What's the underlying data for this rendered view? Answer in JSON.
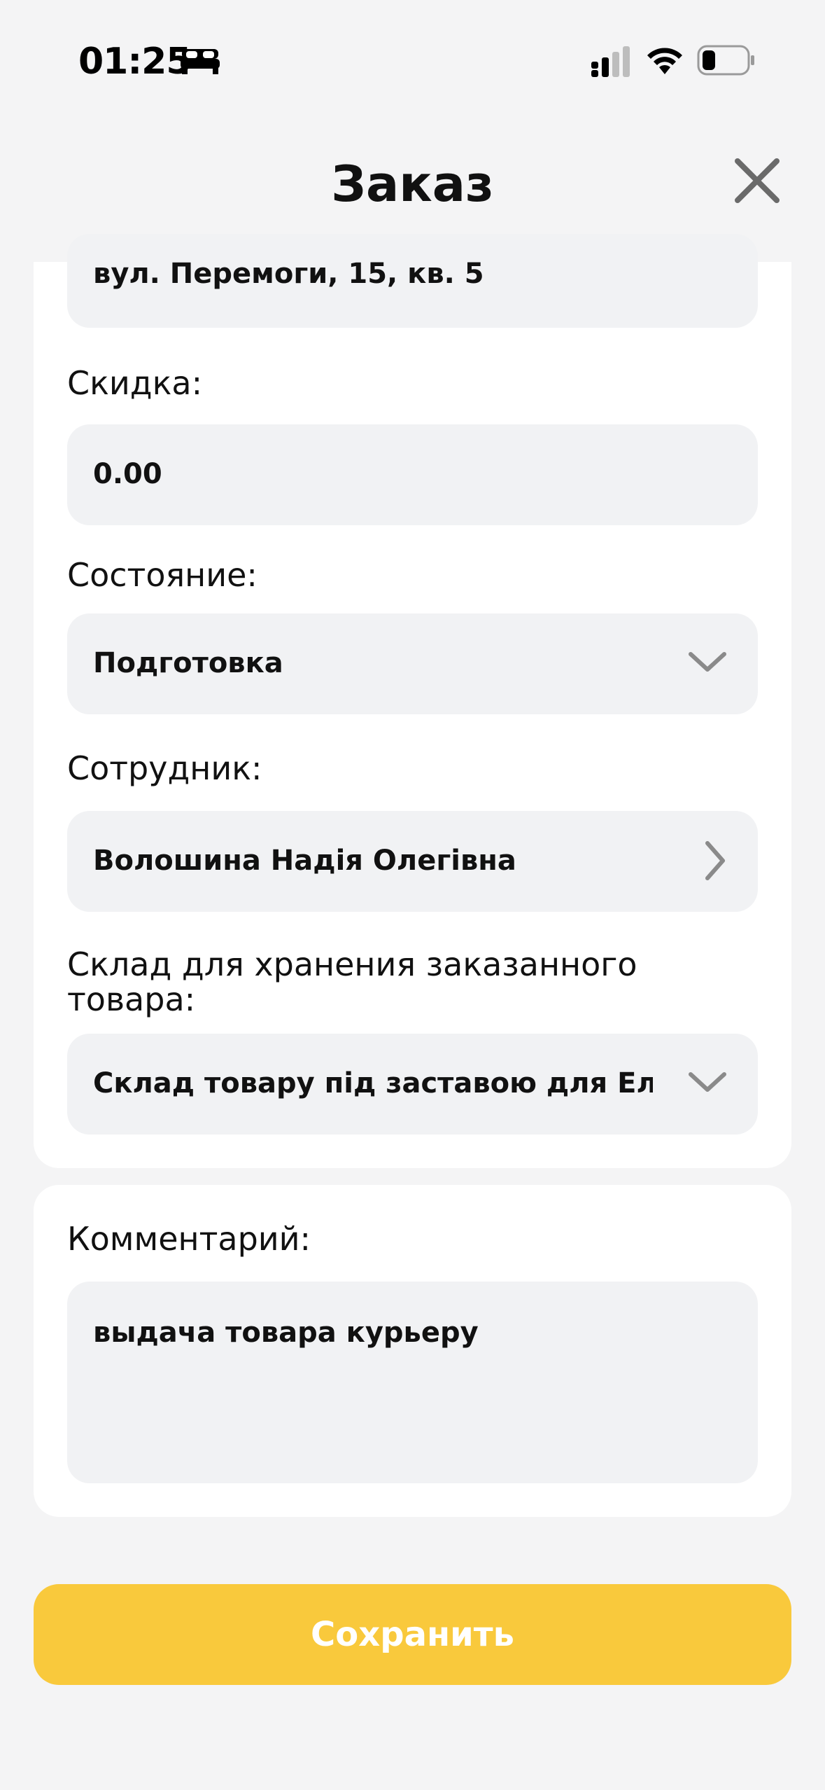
{
  "status_bar": {
    "time": "01:25",
    "icons": [
      "bed-icon",
      "cellular-signal-icon",
      "wifi-icon",
      "battery-icon"
    ]
  },
  "header": {
    "title": "Заказ",
    "close_icon": "close-icon"
  },
  "form": {
    "address": {
      "value": "вул. Перемоги, 15, кв. 5"
    },
    "discount": {
      "label": "Скидка:",
      "value": "0.00"
    },
    "state": {
      "label": "Состояние:",
      "value": "Подготовка"
    },
    "employee": {
      "label": "Сотрудник:",
      "value": "Волошина Надія Олегівна"
    },
    "warehouse": {
      "label": "Склад для хранения заказанного товара:",
      "value": "Склад товару під заставою для Еліт"
    }
  },
  "comment": {
    "label": "Комментарий:",
    "value": "выдача товара курьеру"
  },
  "actions": {
    "save_label": "Сохранить"
  },
  "colors": {
    "background": "#f4f4f5",
    "field": "#f1f2f4",
    "accent": "#f9c93c"
  }
}
